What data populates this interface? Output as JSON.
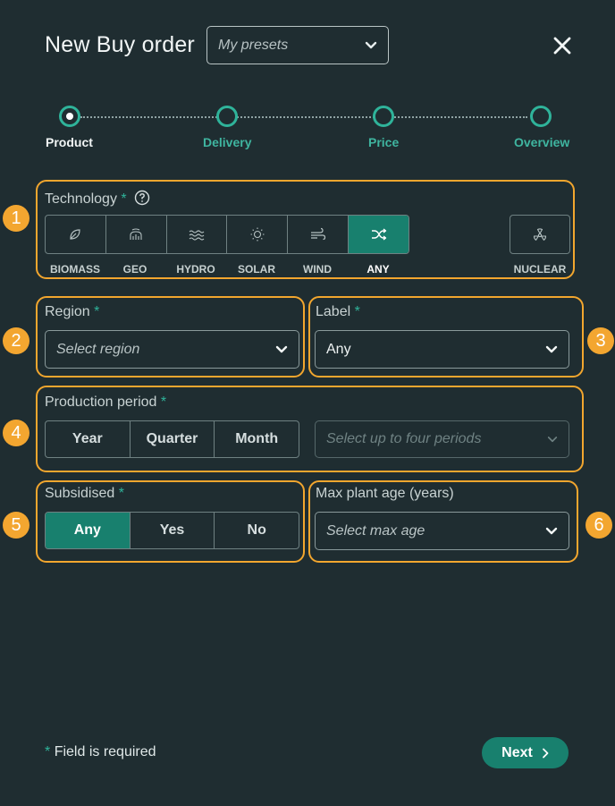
{
  "header": {
    "title": "New Buy order",
    "presets_placeholder": "My presets"
  },
  "steps": [
    {
      "label": "Product",
      "active": true
    },
    {
      "label": "Delivery",
      "active": false
    },
    {
      "label": "Price",
      "active": false
    },
    {
      "label": "Overview",
      "active": false
    }
  ],
  "annotations": [
    "1",
    "2",
    "3",
    "4",
    "5",
    "6"
  ],
  "technology": {
    "label": "Technology",
    "required_mark": "*",
    "options": [
      {
        "name": "BIOMASS",
        "icon": "leaf-icon"
      },
      {
        "name": "GEO",
        "icon": "geothermal-icon"
      },
      {
        "name": "HYDRO",
        "icon": "waves-icon"
      },
      {
        "name": "SOLAR",
        "icon": "sun-icon"
      },
      {
        "name": "WIND",
        "icon": "wind-icon"
      },
      {
        "name": "ANY",
        "icon": "shuffle-icon",
        "selected": true
      }
    ],
    "nuclear": {
      "name": "NUCLEAR",
      "icon": "radiation-icon"
    }
  },
  "region": {
    "label": "Region",
    "required_mark": "*",
    "placeholder": "Select region"
  },
  "label_field": {
    "label": "Label",
    "required_mark": "*",
    "value": "Any"
  },
  "production_period": {
    "label": "Production period",
    "required_mark": "*",
    "options": [
      "Year",
      "Quarter",
      "Month"
    ],
    "select_placeholder": "Select up to four periods"
  },
  "subsidised": {
    "label": "Subsidised",
    "required_mark": "*",
    "options": [
      "Any",
      "Yes",
      "No"
    ],
    "selected": "Any"
  },
  "max_plant_age": {
    "label": "Max plant age (years)",
    "placeholder": "Select max age"
  },
  "footer": {
    "required_mark": "*",
    "note": "Field is required",
    "next_label": "Next"
  },
  "colors": {
    "background": "#1f2d31",
    "accent": "#18806e",
    "annotation": "#f2a62e"
  }
}
